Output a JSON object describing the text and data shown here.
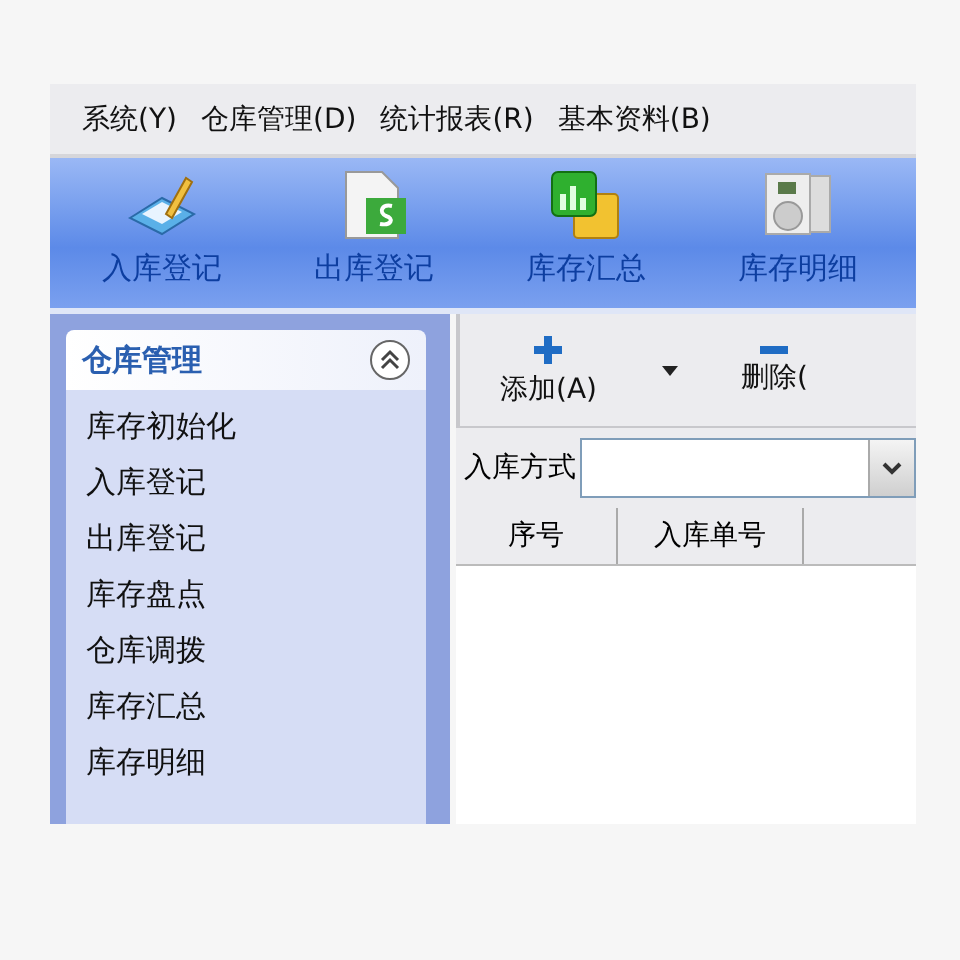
{
  "menu_bar": {
    "items": [
      {
        "label": "系统(Y)"
      },
      {
        "label": "仓库管理(D)"
      },
      {
        "label": "统计报表(R)"
      },
      {
        "label": "基本资料(B)"
      }
    ]
  },
  "toolbar": {
    "buttons": [
      {
        "label": "入库登记",
        "kind": "edit"
      },
      {
        "label": "出库登记",
        "kind": "money"
      },
      {
        "label": "库存汇总",
        "kind": "chart"
      },
      {
        "label": "库存明细",
        "kind": "disc"
      }
    ]
  },
  "sidebar": {
    "title": "仓库管理",
    "expanded": true,
    "items": [
      {
        "label": "库存初始化"
      },
      {
        "label": "入库登记"
      },
      {
        "label": "出库登记"
      },
      {
        "label": "库存盘点"
      },
      {
        "label": "仓库调拨"
      },
      {
        "label": "库存汇总"
      },
      {
        "label": "库存明细"
      }
    ]
  },
  "actions": [
    {
      "label": "添加(A)",
      "kind": "add"
    },
    {
      "label": "删除(",
      "kind": "delete"
    }
  ],
  "filter": {
    "label": "入库方式"
  },
  "table": {
    "columns": [
      "序号",
      "入库单号"
    ]
  }
}
